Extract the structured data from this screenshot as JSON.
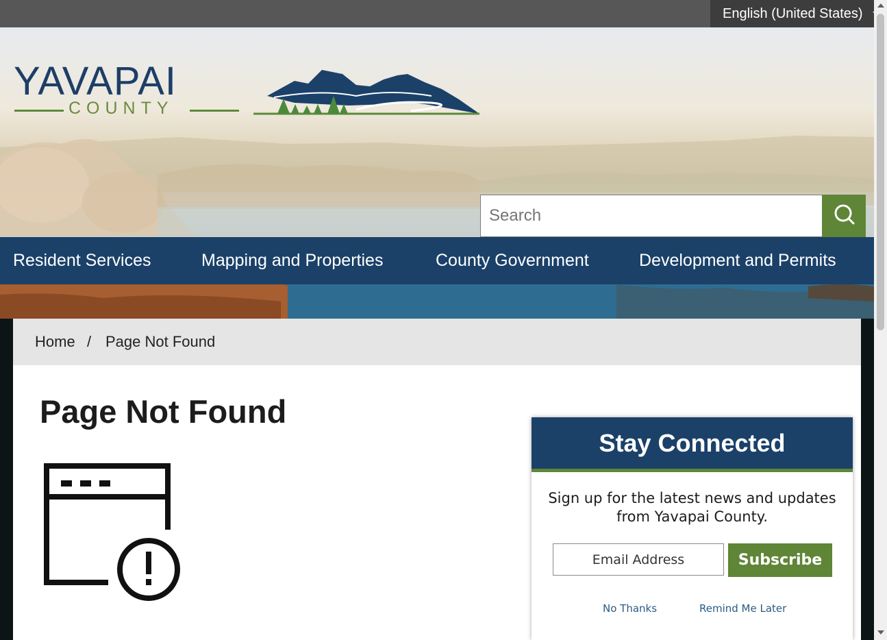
{
  "language": {
    "selected": "English (United States)"
  },
  "logo": {
    "name": "YAVAPAI",
    "sub": "COUNTY"
  },
  "search": {
    "placeholder": "Search"
  },
  "nav": {
    "items": [
      {
        "label": "Resident Services"
      },
      {
        "label": "Mapping and Properties"
      },
      {
        "label": "County Government"
      },
      {
        "label": "Development and Permits"
      }
    ]
  },
  "breadcrumb": {
    "home": "Home",
    "separator": "/",
    "current": "Page Not Found"
  },
  "main": {
    "title": "Page Not Found",
    "icon": "browser-error-icon"
  },
  "stay_connected": {
    "title": "Stay Connected",
    "description": "Sign up for the latest news and updates from Yavapai County.",
    "email_placeholder": "Email Address",
    "subscribe_label": "Subscribe",
    "no_thanks_label": "No Thanks",
    "remind_label": "Remind Me Later"
  },
  "colors": {
    "navy": "#1b4169",
    "green": "#5f8537",
    "topbar": "#575757"
  }
}
